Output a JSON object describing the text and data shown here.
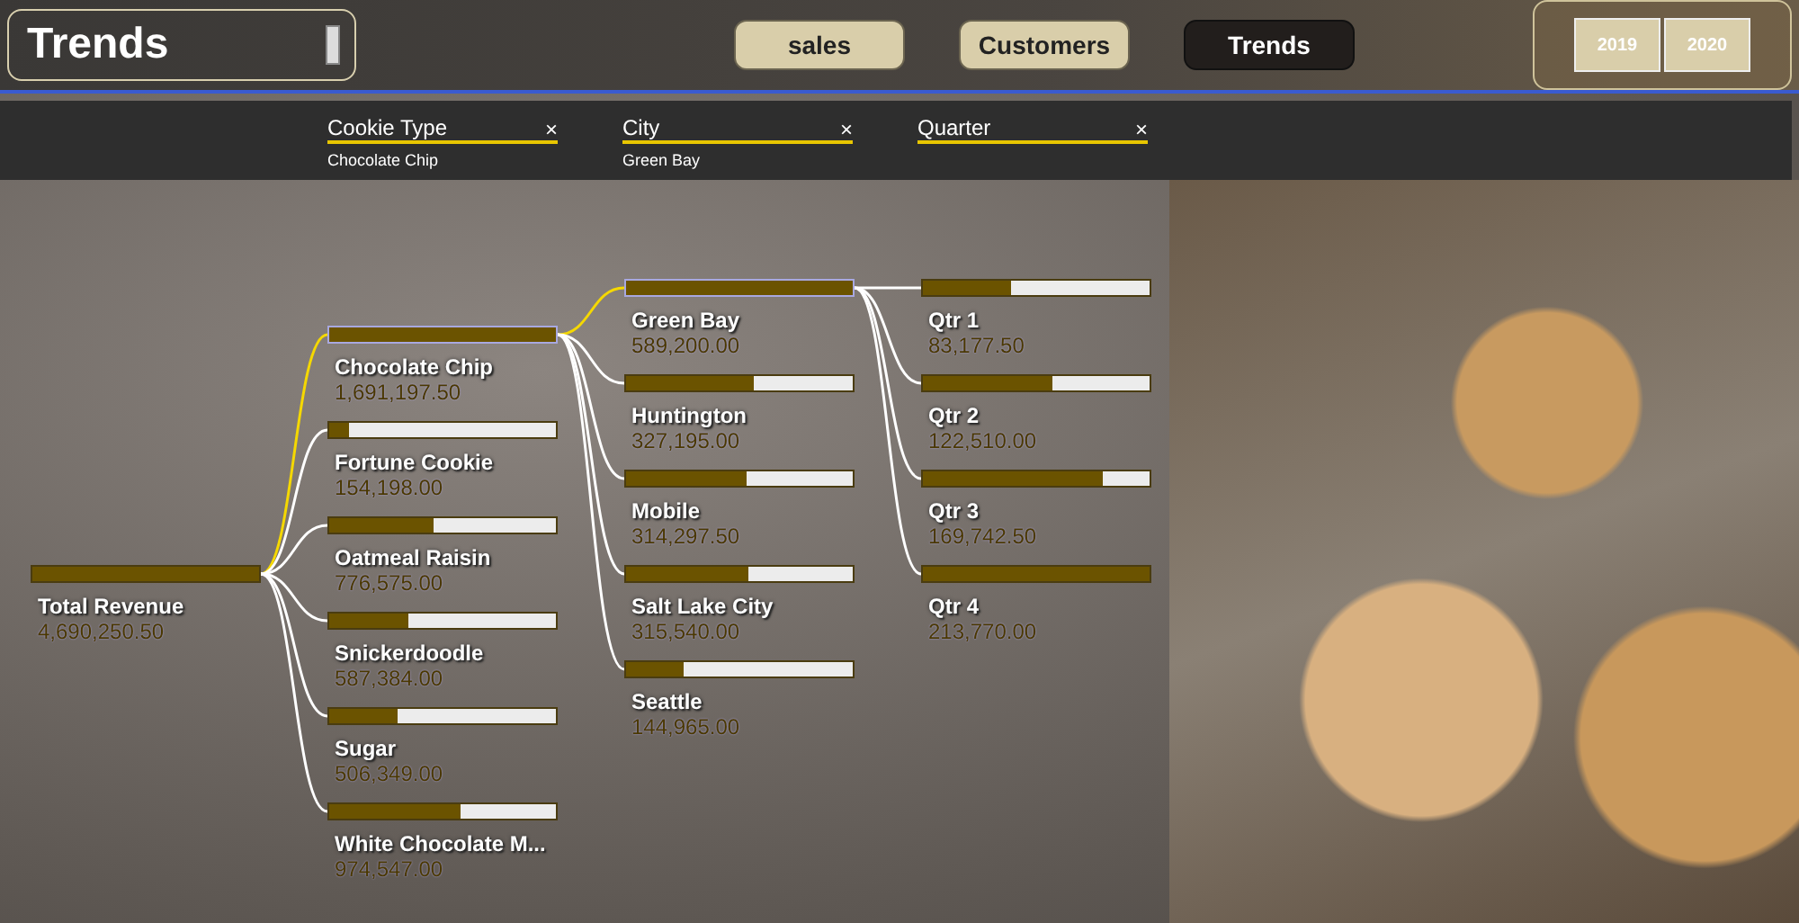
{
  "header": {
    "title": "Trends",
    "nav": [
      {
        "label": "sales",
        "selected": false
      },
      {
        "label": "Customers",
        "selected": false
      },
      {
        "label": "Trends",
        "selected": true
      }
    ],
    "years": [
      "2019",
      "2020"
    ]
  },
  "filters": [
    {
      "label": "Cookie Type",
      "value": "Chocolate Chip",
      "close": "×"
    },
    {
      "label": "City",
      "value": "Green Bay",
      "close": "×"
    },
    {
      "label": "Quarter",
      "close": "×"
    }
  ],
  "tree": {
    "root": {
      "label": "Total Revenue",
      "value": "4,690,250.50",
      "level": 1
    },
    "levels": [
      {
        "nodes": [
          {
            "label": "Chocolate Chip",
            "value": "1,691,197.50",
            "level": 1,
            "selected": true
          },
          {
            "label": "Fortune Cookie",
            "value": "154,198.00",
            "level": 0.09,
            "selected": false
          },
          {
            "label": "Oatmeal Raisin",
            "value": "776,575.00",
            "level": 0.46,
            "selected": false
          },
          {
            "label": "Snickerdoodle",
            "value": "587,384.00",
            "level": 0.35,
            "selected": false
          },
          {
            "label": "Sugar",
            "value": "506,349.00",
            "level": 0.3,
            "selected": false
          },
          {
            "label": "White Chocolate M...",
            "value": "974,547.00",
            "level": 0.58,
            "selected": false
          }
        ]
      },
      {
        "nodes": [
          {
            "label": "Green Bay",
            "value": "589,200.00",
            "level": 1,
            "selected": true
          },
          {
            "label": "Huntington",
            "value": "327,195.00",
            "level": 0.56,
            "selected": false
          },
          {
            "label": "Mobile",
            "value": "314,297.50",
            "level": 0.53,
            "selected": false
          },
          {
            "label": "Salt Lake City",
            "value": "315,540.00",
            "level": 0.54,
            "selected": false
          },
          {
            "label": "Seattle",
            "value": "144,965.00",
            "level": 0.25,
            "selected": false
          }
        ]
      },
      {
        "nodes": [
          {
            "label": "Qtr 1",
            "value": "83,177.50",
            "level": 0.39,
            "selected": false
          },
          {
            "label": "Qtr 2",
            "value": "122,510.00",
            "level": 0.57,
            "selected": false
          },
          {
            "label": "Qtr 3",
            "value": "169,742.50",
            "level": 0.79,
            "selected": false
          },
          {
            "label": "Qtr 4",
            "value": "213,770.00",
            "level": 1,
            "selected": false
          }
        ]
      }
    ]
  }
}
